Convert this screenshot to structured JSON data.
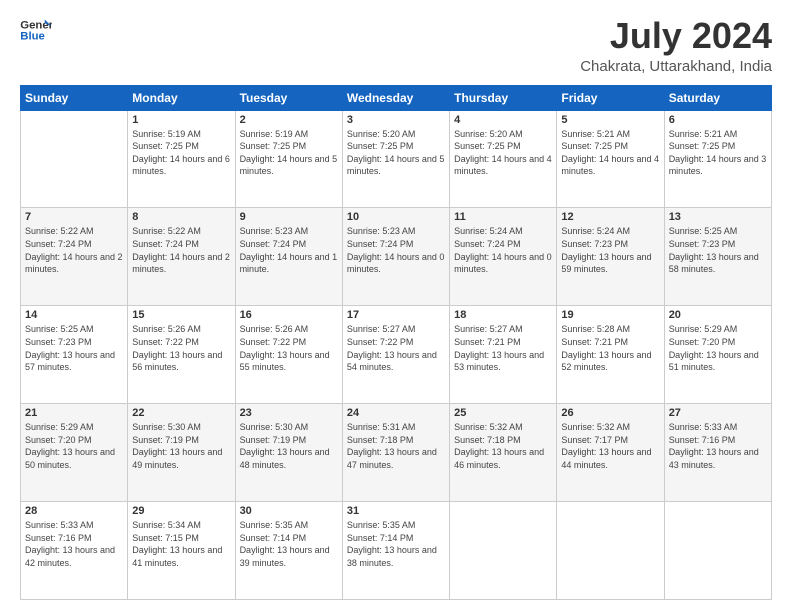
{
  "logo": {
    "line1": "General",
    "line2": "Blue"
  },
  "title": "July 2024",
  "subtitle": "Chakrata, Uttarakhand, India",
  "days_of_week": [
    "Sunday",
    "Monday",
    "Tuesday",
    "Wednesday",
    "Thursday",
    "Friday",
    "Saturday"
  ],
  "weeks": [
    [
      {
        "day": "",
        "sunrise": "",
        "sunset": "",
        "daylight": ""
      },
      {
        "day": "1",
        "sunrise": "Sunrise: 5:19 AM",
        "sunset": "Sunset: 7:25 PM",
        "daylight": "Daylight: 14 hours and 6 minutes."
      },
      {
        "day": "2",
        "sunrise": "Sunrise: 5:19 AM",
        "sunset": "Sunset: 7:25 PM",
        "daylight": "Daylight: 14 hours and 5 minutes."
      },
      {
        "day": "3",
        "sunrise": "Sunrise: 5:20 AM",
        "sunset": "Sunset: 7:25 PM",
        "daylight": "Daylight: 14 hours and 5 minutes."
      },
      {
        "day": "4",
        "sunrise": "Sunrise: 5:20 AM",
        "sunset": "Sunset: 7:25 PM",
        "daylight": "Daylight: 14 hours and 4 minutes."
      },
      {
        "day": "5",
        "sunrise": "Sunrise: 5:21 AM",
        "sunset": "Sunset: 7:25 PM",
        "daylight": "Daylight: 14 hours and 4 minutes."
      },
      {
        "day": "6",
        "sunrise": "Sunrise: 5:21 AM",
        "sunset": "Sunset: 7:25 PM",
        "daylight": "Daylight: 14 hours and 3 minutes."
      }
    ],
    [
      {
        "day": "7",
        "sunrise": "Sunrise: 5:22 AM",
        "sunset": "Sunset: 7:24 PM",
        "daylight": "Daylight: 14 hours and 2 minutes."
      },
      {
        "day": "8",
        "sunrise": "Sunrise: 5:22 AM",
        "sunset": "Sunset: 7:24 PM",
        "daylight": "Daylight: 14 hours and 2 minutes."
      },
      {
        "day": "9",
        "sunrise": "Sunrise: 5:23 AM",
        "sunset": "Sunset: 7:24 PM",
        "daylight": "Daylight: 14 hours and 1 minute."
      },
      {
        "day": "10",
        "sunrise": "Sunrise: 5:23 AM",
        "sunset": "Sunset: 7:24 PM",
        "daylight": "Daylight: 14 hours and 0 minutes."
      },
      {
        "day": "11",
        "sunrise": "Sunrise: 5:24 AM",
        "sunset": "Sunset: 7:24 PM",
        "daylight": "Daylight: 14 hours and 0 minutes."
      },
      {
        "day": "12",
        "sunrise": "Sunrise: 5:24 AM",
        "sunset": "Sunset: 7:23 PM",
        "daylight": "Daylight: 13 hours and 59 minutes."
      },
      {
        "day": "13",
        "sunrise": "Sunrise: 5:25 AM",
        "sunset": "Sunset: 7:23 PM",
        "daylight": "Daylight: 13 hours and 58 minutes."
      }
    ],
    [
      {
        "day": "14",
        "sunrise": "Sunrise: 5:25 AM",
        "sunset": "Sunset: 7:23 PM",
        "daylight": "Daylight: 13 hours and 57 minutes."
      },
      {
        "day": "15",
        "sunrise": "Sunrise: 5:26 AM",
        "sunset": "Sunset: 7:22 PM",
        "daylight": "Daylight: 13 hours and 56 minutes."
      },
      {
        "day": "16",
        "sunrise": "Sunrise: 5:26 AM",
        "sunset": "Sunset: 7:22 PM",
        "daylight": "Daylight: 13 hours and 55 minutes."
      },
      {
        "day": "17",
        "sunrise": "Sunrise: 5:27 AM",
        "sunset": "Sunset: 7:22 PM",
        "daylight": "Daylight: 13 hours and 54 minutes."
      },
      {
        "day": "18",
        "sunrise": "Sunrise: 5:27 AM",
        "sunset": "Sunset: 7:21 PM",
        "daylight": "Daylight: 13 hours and 53 minutes."
      },
      {
        "day": "19",
        "sunrise": "Sunrise: 5:28 AM",
        "sunset": "Sunset: 7:21 PM",
        "daylight": "Daylight: 13 hours and 52 minutes."
      },
      {
        "day": "20",
        "sunrise": "Sunrise: 5:29 AM",
        "sunset": "Sunset: 7:20 PM",
        "daylight": "Daylight: 13 hours and 51 minutes."
      }
    ],
    [
      {
        "day": "21",
        "sunrise": "Sunrise: 5:29 AM",
        "sunset": "Sunset: 7:20 PM",
        "daylight": "Daylight: 13 hours and 50 minutes."
      },
      {
        "day": "22",
        "sunrise": "Sunrise: 5:30 AM",
        "sunset": "Sunset: 7:19 PM",
        "daylight": "Daylight: 13 hours and 49 minutes."
      },
      {
        "day": "23",
        "sunrise": "Sunrise: 5:30 AM",
        "sunset": "Sunset: 7:19 PM",
        "daylight": "Daylight: 13 hours and 48 minutes."
      },
      {
        "day": "24",
        "sunrise": "Sunrise: 5:31 AM",
        "sunset": "Sunset: 7:18 PM",
        "daylight": "Daylight: 13 hours and 47 minutes."
      },
      {
        "day": "25",
        "sunrise": "Sunrise: 5:32 AM",
        "sunset": "Sunset: 7:18 PM",
        "daylight": "Daylight: 13 hours and 46 minutes."
      },
      {
        "day": "26",
        "sunrise": "Sunrise: 5:32 AM",
        "sunset": "Sunset: 7:17 PM",
        "daylight": "Daylight: 13 hours and 44 minutes."
      },
      {
        "day": "27",
        "sunrise": "Sunrise: 5:33 AM",
        "sunset": "Sunset: 7:16 PM",
        "daylight": "Daylight: 13 hours and 43 minutes."
      }
    ],
    [
      {
        "day": "28",
        "sunrise": "Sunrise: 5:33 AM",
        "sunset": "Sunset: 7:16 PM",
        "daylight": "Daylight: 13 hours and 42 minutes."
      },
      {
        "day": "29",
        "sunrise": "Sunrise: 5:34 AM",
        "sunset": "Sunset: 7:15 PM",
        "daylight": "Daylight: 13 hours and 41 minutes."
      },
      {
        "day": "30",
        "sunrise": "Sunrise: 5:35 AM",
        "sunset": "Sunset: 7:14 PM",
        "daylight": "Daylight: 13 hours and 39 minutes."
      },
      {
        "day": "31",
        "sunrise": "Sunrise: 5:35 AM",
        "sunset": "Sunset: 7:14 PM",
        "daylight": "Daylight: 13 hours and 38 minutes."
      },
      {
        "day": "",
        "sunrise": "",
        "sunset": "",
        "daylight": ""
      },
      {
        "day": "",
        "sunrise": "",
        "sunset": "",
        "daylight": ""
      },
      {
        "day": "",
        "sunrise": "",
        "sunset": "",
        "daylight": ""
      }
    ]
  ]
}
